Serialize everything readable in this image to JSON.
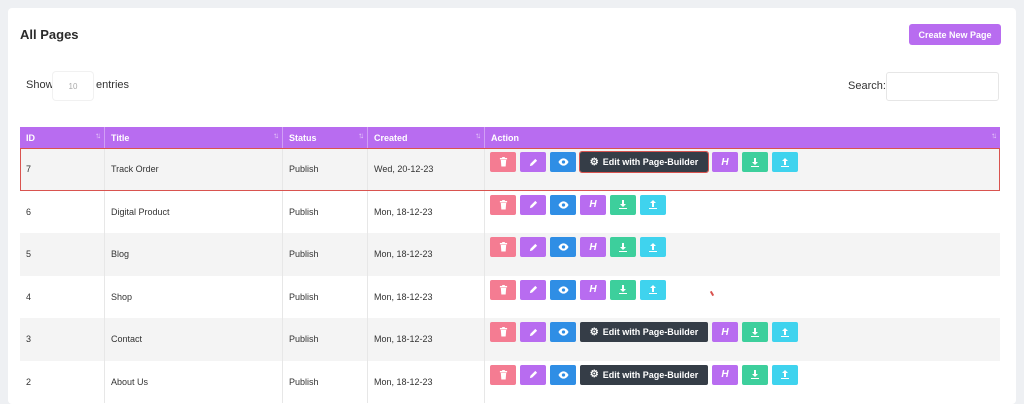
{
  "header": {
    "title": "All Pages",
    "create_label": "Create New Page"
  },
  "controls": {
    "show_label": "Show",
    "entries_value": "10",
    "entries_label": "entries",
    "search_label": "Search:",
    "search_value": ""
  },
  "columns": [
    "ID",
    "Title",
    "Status",
    "Created",
    "Action"
  ],
  "sort_glyph": "↑↓",
  "action_labels": {
    "page_builder": "Edit with Page-Builder",
    "h_label": "H"
  },
  "colors": {
    "accent": "#b86cf0",
    "delete": "#f47c92",
    "view": "#2f8ee5",
    "download": "#3dcf9c",
    "upload": "#3fd3ee",
    "page_builder": "#353d47",
    "highlight": "#d9534f"
  },
  "rows": [
    {
      "id": "7",
      "title": "Track Order",
      "status": "Publish",
      "created": "Wed, 20-12-23",
      "page_builder": true,
      "highlighted": true
    },
    {
      "id": "6",
      "title": "Digital Product",
      "status": "Publish",
      "created": "Mon, 18-12-23",
      "page_builder": false,
      "highlighted": false
    },
    {
      "id": "5",
      "title": "Blog",
      "status": "Publish",
      "created": "Mon, 18-12-23",
      "page_builder": false,
      "highlighted": false
    },
    {
      "id": "4",
      "title": "Shop",
      "status": "Publish",
      "created": "Mon, 18-12-23",
      "page_builder": false,
      "highlighted": false
    },
    {
      "id": "3",
      "title": "Contact",
      "status": "Publish",
      "created": "Mon, 18-12-23",
      "page_builder": true,
      "highlighted": false
    },
    {
      "id": "2",
      "title": "About Us",
      "status": "Publish",
      "created": "Mon, 18-12-23",
      "page_builder": true,
      "highlighted": false
    }
  ]
}
